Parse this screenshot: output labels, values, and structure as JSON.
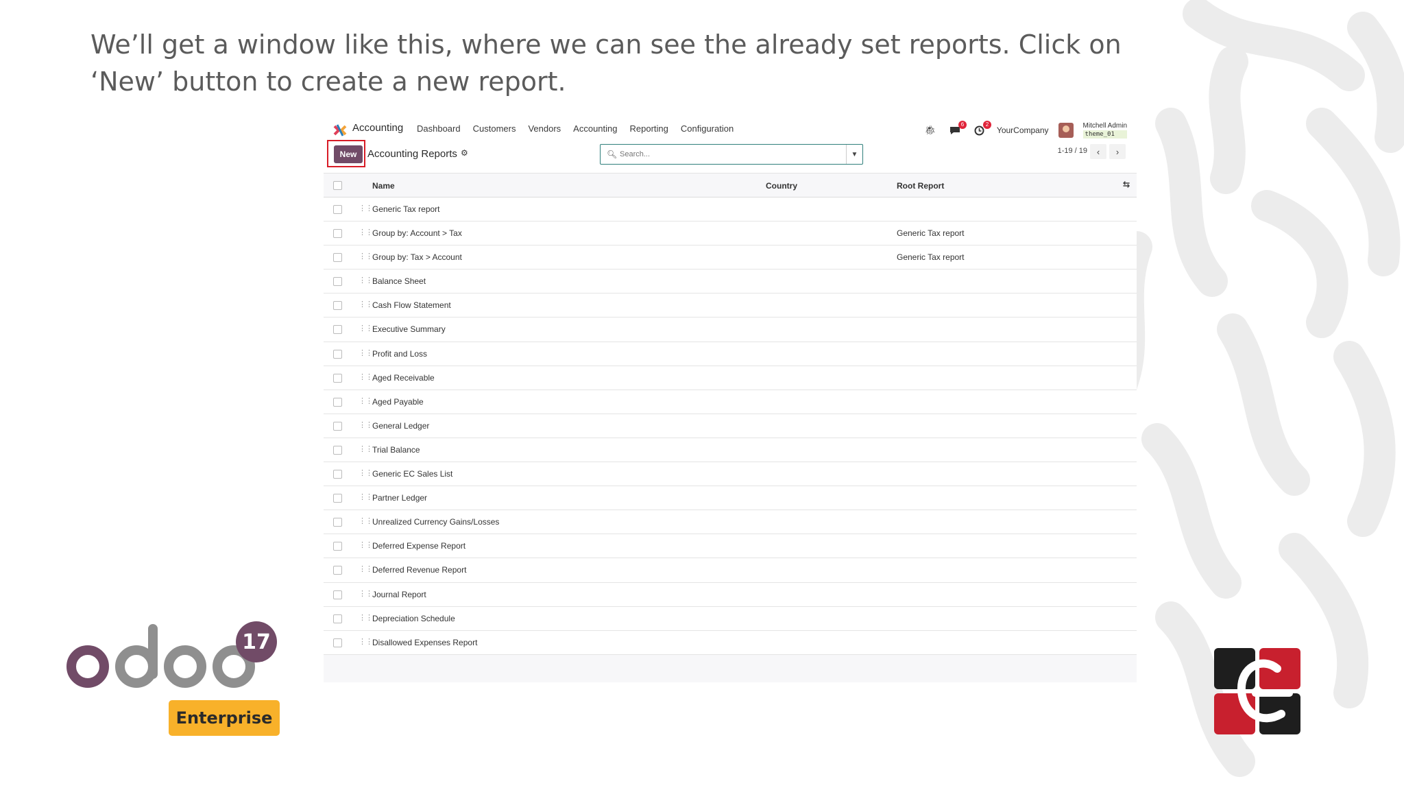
{
  "slide": {
    "text": "We’ll get a window like this, where we can see the already set reports. Click on ‘New’ button to create a new report."
  },
  "navbar": {
    "app_name": "Accounting",
    "menu": [
      "Dashboard",
      "Customers",
      "Vendors",
      "Accounting",
      "Reporting",
      "Configuration"
    ],
    "messages_badge": "6",
    "activities_badge": "2",
    "company": "YourCompany",
    "user_name": "Mitchell Admin",
    "database": "theme_01"
  },
  "control": {
    "new_label": "New",
    "title": "Accounting Reports",
    "search_placeholder": "Search...",
    "pager": "1-19 / 19"
  },
  "table": {
    "columns": [
      "Name",
      "Country",
      "Root Report"
    ],
    "rows": [
      {
        "name": "Generic Tax report",
        "country": "",
        "root": ""
      },
      {
        "name": "Group by: Account > Tax",
        "country": "",
        "root": "Generic Tax report"
      },
      {
        "name": "Group by: Tax > Account",
        "country": "",
        "root": "Generic Tax report"
      },
      {
        "name": "Balance Sheet",
        "country": "",
        "root": ""
      },
      {
        "name": "Cash Flow Statement",
        "country": "",
        "root": ""
      },
      {
        "name": "Executive Summary",
        "country": "",
        "root": ""
      },
      {
        "name": "Profit and Loss",
        "country": "",
        "root": ""
      },
      {
        "name": "Aged Receivable",
        "country": "",
        "root": ""
      },
      {
        "name": "Aged Payable",
        "country": "",
        "root": ""
      },
      {
        "name": "General Ledger",
        "country": "",
        "root": ""
      },
      {
        "name": "Trial Balance",
        "country": "",
        "root": ""
      },
      {
        "name": "Generic EC Sales List",
        "country": "",
        "root": ""
      },
      {
        "name": "Partner Ledger",
        "country": "",
        "root": ""
      },
      {
        "name": "Unrealized Currency Gains/Losses",
        "country": "",
        "root": ""
      },
      {
        "name": "Deferred Expense Report",
        "country": "",
        "root": ""
      },
      {
        "name": "Deferred Revenue Report",
        "country": "",
        "root": ""
      },
      {
        "name": "Journal Report",
        "country": "",
        "root": ""
      },
      {
        "name": "Depreciation Schedule",
        "country": "",
        "root": ""
      },
      {
        "name": "Disallowed Expenses Report",
        "country": "",
        "root": ""
      }
    ]
  },
  "branding": {
    "odoo_wordmark": "odoo",
    "version": "17",
    "edition": "Enterprise",
    "brand_purple": "#714b67",
    "brand_gray": "#8f8f8f",
    "edition_color": "#f8b12a"
  }
}
